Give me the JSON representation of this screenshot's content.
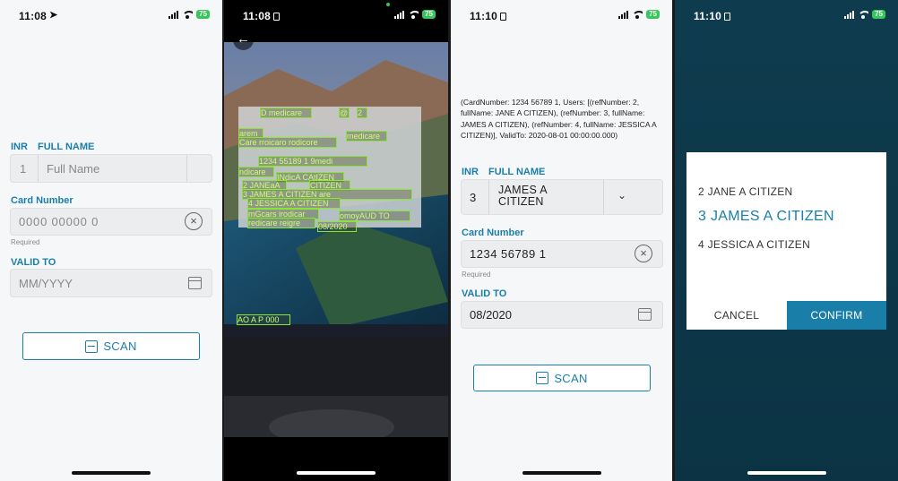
{
  "screen1": {
    "status": {
      "time": "11:08",
      "battery": "75"
    },
    "inr_label": "INR",
    "fullname_label": "FULL NAME",
    "inr_value": "1",
    "fullname_placeholder": "Full Name",
    "card_label": "Card Number",
    "card_placeholder": "0000 00000 0",
    "card_hint": "Required",
    "valid_label": "VALID TO",
    "valid_placeholder": "MM/YYYY",
    "scan_label": "SCAN"
  },
  "screen2": {
    "status": {
      "time": "11:08",
      "battery": "75"
    },
    "ocr_texts": [
      "D medicare",
      "@",
      "2",
      "arem",
      "medicare",
      "Care rroicaro rodicore",
      "1234 55189 1 9medi",
      "ndicare",
      "INdicA CAtIZEN",
      "2 JANEaA",
      "CITIZEN",
      "3 JAMES A CITIZEN are",
      "4 JESSICA A CITIZEN",
      "mGcars irodicar",
      "omoyAUD TO",
      "08/2020",
      "redicare reigre",
      "AO A P 000"
    ]
  },
  "screen3": {
    "status": {
      "time": "11:10",
      "battery": "75"
    },
    "raw_text": "(CardNumber: 1234 56789 1, Users: [(refNumber: 2, fullName: JANE A CITIZEN), (refNumber: 3, fullName: JAMES A CITIZEN), (refNumber: 4, fullName: JESSICA A CITIZEN)], ValidTo: 2020-08-01 00:00:00.000)",
    "inr_label": "INR",
    "fullname_label": "FULL NAME",
    "inr_value": "3",
    "fullname_value": "JAMES A\nCITIZEN",
    "card_label": "Card Number",
    "card_value": "1234 56789 1",
    "card_hint": "Required",
    "valid_label": "VALID TO",
    "valid_value": "08/2020",
    "scan_label": "SCAN"
  },
  "screen4": {
    "status": {
      "time": "11:10",
      "battery": "75"
    },
    "options": [
      "2  JANE A CITIZEN",
      "3  JAMES A CITIZEN",
      "4  JESSICA A CITIZEN"
    ],
    "cancel_label": "CANCEL",
    "confirm_label": "CONFIRM"
  },
  "colors": {
    "accent": "#1a7fa8",
    "ocr_green": "#8be43a"
  }
}
